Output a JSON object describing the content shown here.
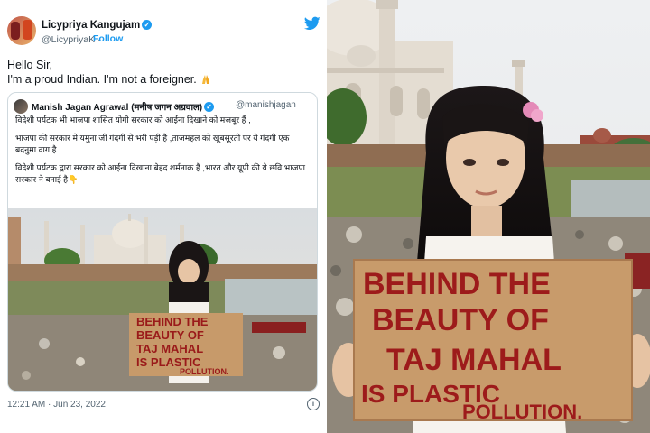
{
  "tweet": {
    "author_name": "Licypriya Kangujam",
    "author_handle": "@LicypriyaK",
    "follow_label": "Follow",
    "line1": "Hello Sir,",
    "line2": "I'm a proud Indian. I'm not a foreigner.",
    "timestamp": "12:21 AM · Jun 23, 2022",
    "brand_color": "#1d9bf0"
  },
  "quoted_tweet": {
    "author_name": "Manish Jagan Agrawal (मनीष जगन अग्रवाल)",
    "author_handle": "@manishjagan",
    "para1": "विदेशी पर्यटक भी भाजपा शासित योगी सरकार को आईना दिखाने को मजबूर हैं ,",
    "para2": "भाजपा की सरकार में यमुना जी गंदगी से भरी पड़ी हैं ,ताजमहल को खूबसूरती पर ये गंदगी एक बदनुमा दाग है ,",
    "para3": "विदेशी पर्यटक द्वारा सरकार को आईना दिखाना बेहद शर्मनाक है ,भारत और यूपी की ये छवि भाजपा सरकार ने बनाई है👇"
  },
  "placard": {
    "line1": "BEHIND THE",
    "line2": "BEAUTY OF",
    "line3": "TAJ MAHAL",
    "line4": "IS PLASTIC",
    "line5": "POLLUTION."
  },
  "icons": {
    "twitter": "twitter-bird-icon",
    "verified": "verified-badge-icon",
    "pray": "folded-hands-icon",
    "info": "info-icon"
  }
}
